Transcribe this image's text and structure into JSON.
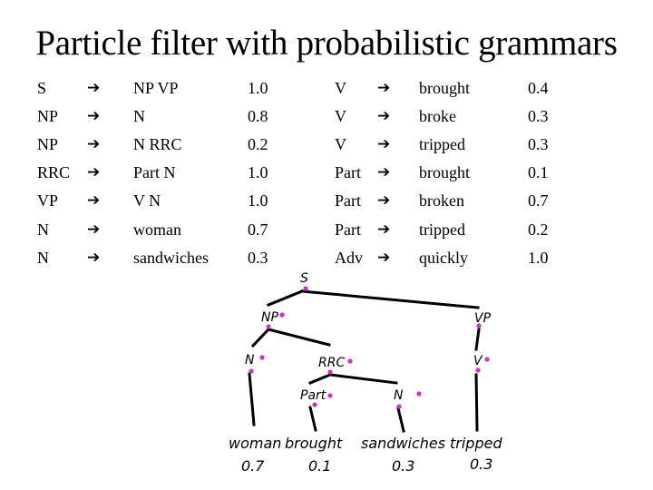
{
  "title": "Particle filter with probabilistic grammars",
  "arrow_icon": "➔",
  "colors": {
    "text": "#000000",
    "particle_dot": "#cc33cc",
    "background": "#ffffff"
  },
  "grammar": {
    "left_rules": [
      {
        "lhs": "S",
        "rhs": "NP VP",
        "prob": "1.0"
      },
      {
        "lhs": "NP",
        "rhs": "N",
        "prob": "0.8"
      },
      {
        "lhs": "NP",
        "rhs": "N RRC",
        "prob": "0.2"
      },
      {
        "lhs": "RRC",
        "rhs": "Part N",
        "prob": "1.0"
      },
      {
        "lhs": "VP",
        "rhs": "V N",
        "prob": "1.0"
      },
      {
        "lhs": "N",
        "rhs": "woman",
        "prob": "0.7"
      },
      {
        "lhs": "N",
        "rhs": "sandwiches",
        "prob": "0.3"
      }
    ],
    "right_rules": [
      {
        "lhs": "V",
        "rhs": "brought",
        "prob": "0.4"
      },
      {
        "lhs": "V",
        "rhs": "broke",
        "prob": "0.3"
      },
      {
        "lhs": "V",
        "rhs": "tripped",
        "prob": "0.3"
      },
      {
        "lhs": "Part",
        "rhs": "brought",
        "prob": "0.1"
      },
      {
        "lhs": "Part",
        "rhs": "broken",
        "prob": "0.7"
      },
      {
        "lhs": "Part",
        "rhs": "tripped",
        "prob": "0.2"
      },
      {
        "lhs": "Adv",
        "rhs": "quickly",
        "prob": "1.0"
      }
    ]
  },
  "tree": {
    "nodes": {
      "s": "S",
      "np": "NP",
      "vp": "VP",
      "n1": "N",
      "rrc": "RRC",
      "part": "Part",
      "n2": "N",
      "v": "V"
    },
    "leaves": [
      {
        "word": "woman",
        "prob": "0.7"
      },
      {
        "word": "brought",
        "prob": "0.1"
      },
      {
        "word": "sandwiches",
        "prob": "0.3"
      },
      {
        "word": "tripped",
        "prob": "0.3"
      }
    ]
  }
}
